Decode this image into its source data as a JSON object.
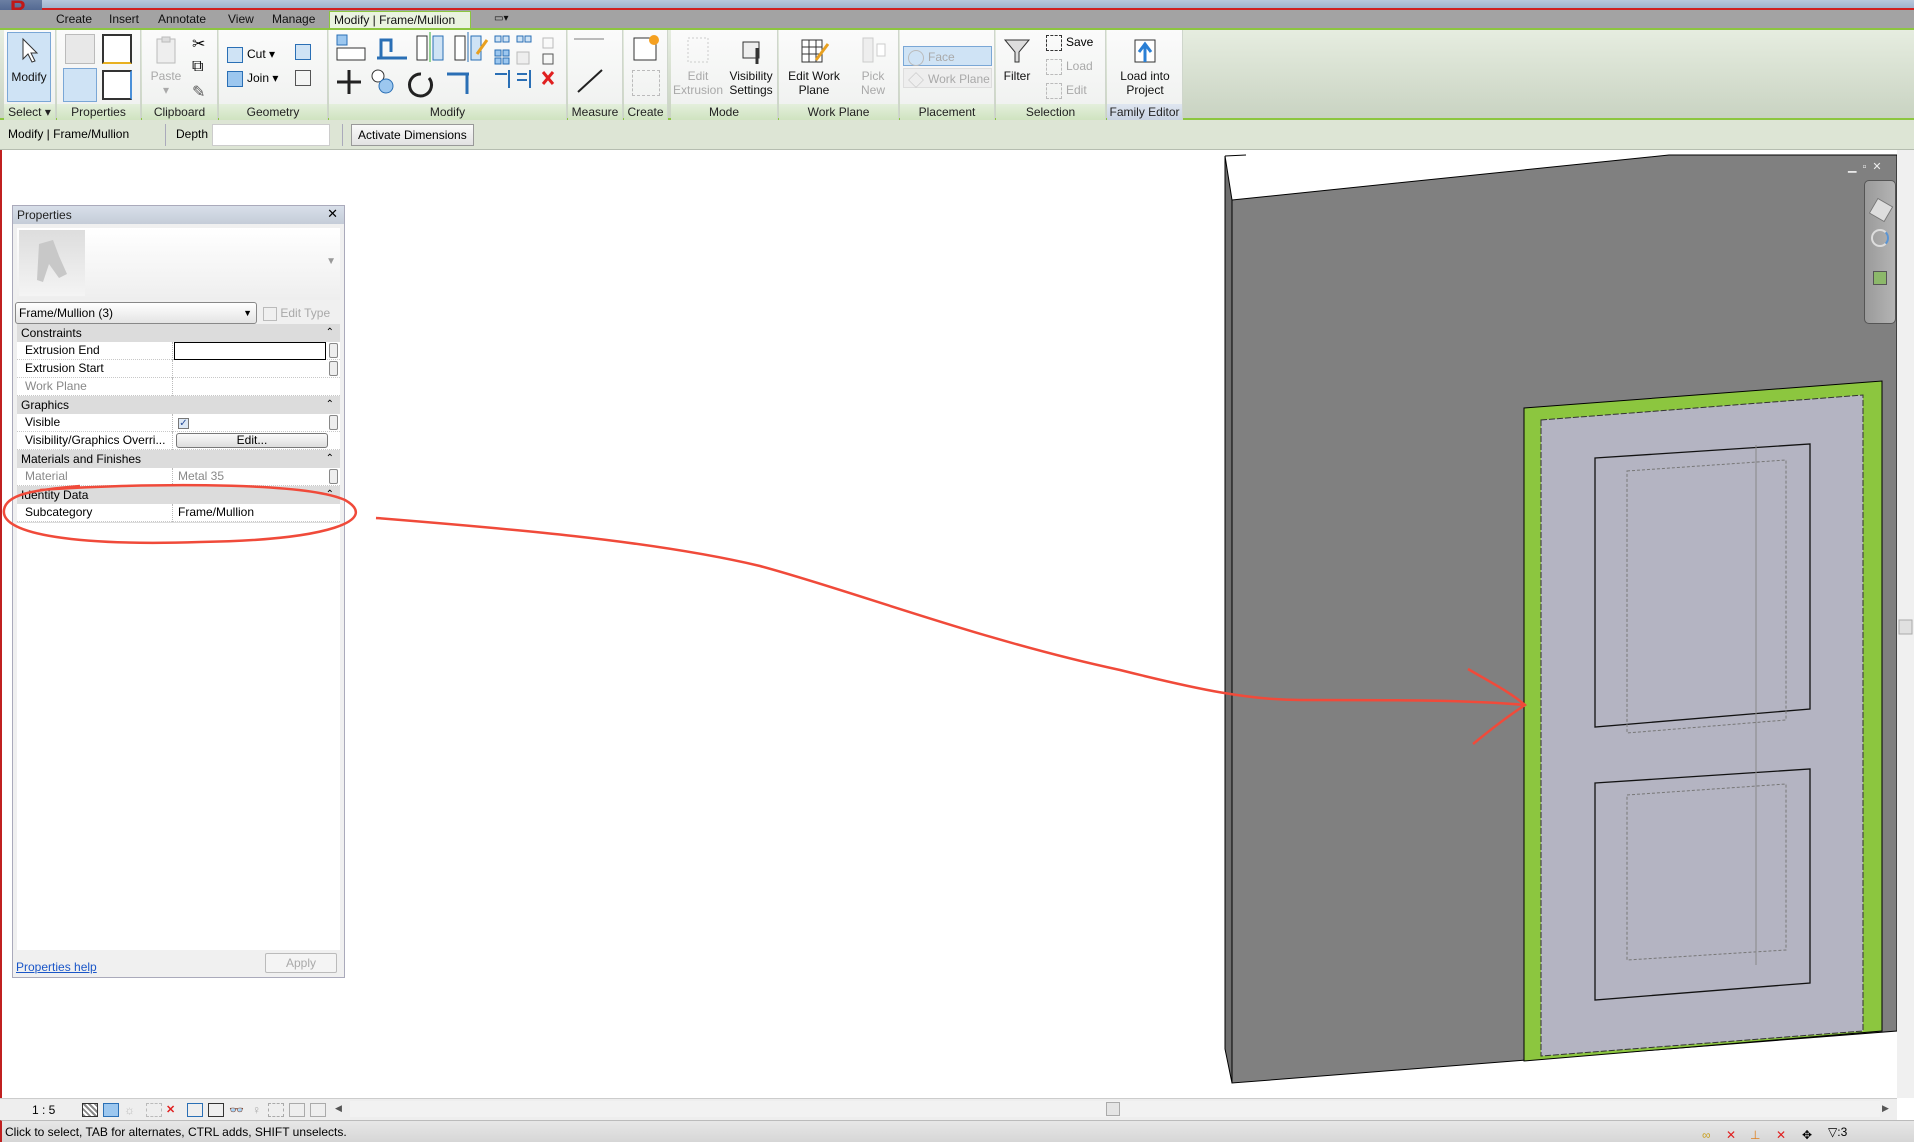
{
  "app": {
    "logo_letter": "R"
  },
  "tabs": [
    {
      "label": "Create"
    },
    {
      "label": "Insert"
    },
    {
      "label": "Annotate"
    },
    {
      "label": "View"
    },
    {
      "label": "Manage"
    },
    {
      "label": "Modify | Frame/Mullion",
      "active": true
    }
  ],
  "ribbon": {
    "select": {
      "modify": "Modify",
      "label": "Select"
    },
    "properties": {
      "label": "Properties"
    },
    "clipboard": {
      "paste": "Paste",
      "label": "Clipboard"
    },
    "geometry": {
      "cut": "Cut",
      "join": "Join",
      "label": "Geometry"
    },
    "modify": {
      "label": "Modify"
    },
    "measure": {
      "label": "Measure"
    },
    "create": {
      "label": "Create"
    },
    "mode": {
      "edit_extrusion": "Edit Extrusion",
      "visibility_settings": "Visibility Settings",
      "label": "Mode"
    },
    "work_plane": {
      "edit_work_plane": "Edit Work Plane",
      "pick_new": "Pick New",
      "label": "Work Plane"
    },
    "placement": {
      "face": "Face",
      "work_plane": "Work Plane",
      "label": "Placement"
    },
    "selection": {
      "filter": "Filter",
      "save": "Save",
      "load": "Load",
      "edit": "Edit",
      "label": "Selection"
    },
    "family_editor": {
      "load_into_project": "Load into Project",
      "label": "Family Editor"
    }
  },
  "options_bar": {
    "context": "Modify | Frame/Mullion",
    "depth_label": "Depth",
    "depth_value": "",
    "activate_dimensions": "Activate Dimensions"
  },
  "properties": {
    "title": "Properties",
    "type_selector": "Frame/Mullion (3)",
    "edit_type": "Edit Type",
    "groups": [
      {
        "name": "Constraints",
        "rows": [
          {
            "name": "Extrusion End",
            "value": ""
          },
          {
            "name": "Extrusion Start",
            "value": ""
          },
          {
            "name": "Work Plane",
            "value": ""
          }
        ]
      },
      {
        "name": "Graphics",
        "rows": [
          {
            "name": "Visible",
            "value": "checked"
          },
          {
            "name": "Visibility/Graphics Overri...",
            "value": "Edit..."
          }
        ]
      },
      {
        "name": "Materials and Finishes",
        "rows": [
          {
            "name": "Material",
            "value": "Metal 35"
          }
        ]
      },
      {
        "name": "Identity Data",
        "rows": [
          {
            "name": "Subcategory",
            "value": "Frame/Mullion"
          }
        ]
      }
    ],
    "help_link": "Properties help",
    "apply": "Apply"
  },
  "view_control_bar": {
    "scale": "1 : 5"
  },
  "status_bar": {
    "message": "Click to select, TAB for alternates, CTRL adds, SHIFT unselects.",
    "filter_count": ":3"
  },
  "colors": {
    "frame_highlight": "#8cc63f",
    "wall": "#808080",
    "door_panel": "#b4b4c2",
    "annotation": "#f04a3a",
    "ribbon_accent": "#8cc63f"
  }
}
